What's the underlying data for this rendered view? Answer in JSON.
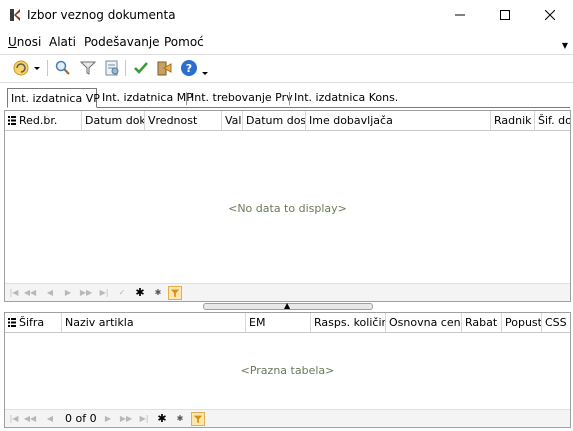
{
  "window": {
    "title": "Izbor veznog dokumenta",
    "minimize_glyph": "—",
    "maximize_glyph": "☐",
    "close_glyph": "✕"
  },
  "menu": {
    "items": [
      "Unosi",
      "Alati",
      "Podešavanje",
      "Pomoć"
    ],
    "overflow_glyph": "▼"
  },
  "toolbar": {
    "icons": [
      "refresh-icon",
      "dropdown-arrow-icon",
      "search-icon",
      "filter-icon",
      "report-icon",
      "confirm-check-icon",
      "exit-icon",
      "help-icon",
      "help-dropdown-icon"
    ]
  },
  "tabs": [
    {
      "label": "Int. izdatnica VP",
      "active": true
    },
    {
      "label": "Int. izdatnica MP",
      "active": false
    },
    {
      "label": "Int. trebovanje Prv",
      "active": false
    },
    {
      "label": "Int. izdatnica Kons.",
      "active": false
    }
  ],
  "top_grid": {
    "columns": [
      "Red.br.",
      "Datum dok.",
      "Vrednost",
      "Valu",
      "Datum dosp",
      "Ime dobavljača",
      "Radnik",
      "Šif. do"
    ],
    "rows": [],
    "empty_message": "<No data to display>",
    "nav_buttons": [
      "|◀◀",
      "◀◀",
      "◀",
      "▶",
      "▶▶",
      "▶▶|",
      "✓",
      "✱",
      "✱",
      "filter"
    ]
  },
  "bottom_grid": {
    "columns": [
      "Šifra",
      "Naziv artikla",
      "EM",
      "Rasps. količina",
      "Osnovna cena",
      "Rabat",
      "Popust",
      "CSS"
    ],
    "rows": [],
    "empty_message": "<Prazna tabela>",
    "record_indicator": "0 of 0"
  },
  "colors": {
    "accent_orange": "#f0a830",
    "check_green": "#3a9a3a",
    "help_blue": "#2a6fcf",
    "empty_text": "#6b7a5a"
  }
}
